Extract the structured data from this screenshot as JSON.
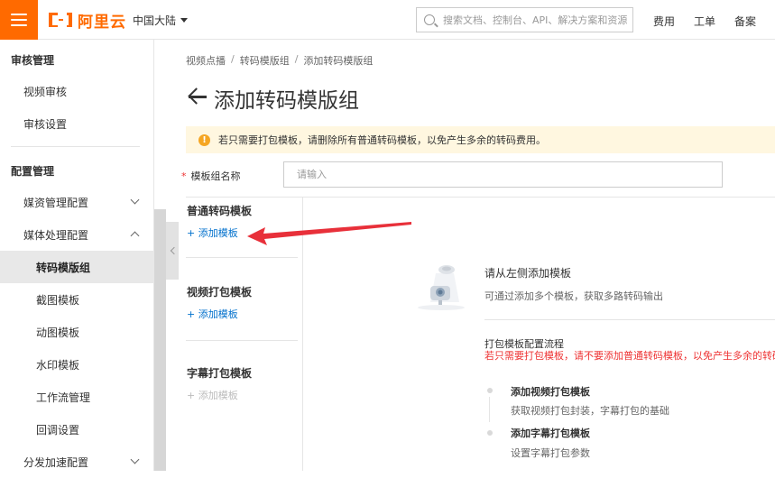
{
  "header": {
    "logo_text": "阿里云",
    "region": "中国大陆",
    "search_placeholder": "搜索文档、控制台、API、解决方案和资源",
    "links": [
      "费用",
      "工单",
      "备案"
    ]
  },
  "sidebar": {
    "group_audit": "审核管理",
    "audit_items": [
      "视频审核",
      "审核设置"
    ],
    "group_config": "配置管理",
    "media_mgmt": "媒资管理配置",
    "media_proc": "媒体处理配置",
    "proc_items": [
      "转码模版组",
      "截图模板",
      "动图模板",
      "水印模板",
      "工作流管理",
      "回调设置"
    ],
    "cdn": "分发加速配置"
  },
  "breadcrumb": [
    "视频点播",
    "转码模版组",
    "添加转码模版组"
  ],
  "page_title": "添加转码模版组",
  "notice": "若只需要打包模板，请删除所有普通转码模板，以免产生多余的转码费用。",
  "form": {
    "name_label": "模板组名称",
    "name_placeholder": "请输入"
  },
  "sections": [
    {
      "title": "普通转码模板",
      "add": "+ 添加模板"
    },
    {
      "title": "视频打包模板",
      "add": "+ 添加模板"
    },
    {
      "title": "字幕打包模板",
      "add": "+ 添加模板"
    }
  ],
  "empty": {
    "title": "请从左侧添加模板",
    "subtitle": "可通过添加多个模板，获取多路转码输出"
  },
  "flow": {
    "title": "打包模板配置流程",
    "warning": "若只需要打包模板，请不要添加普通转码模板，以免产生多余的转码",
    "steps": [
      {
        "title": "添加视频打包模板",
        "desc": "获取视频打包封装，字幕打包的基础"
      },
      {
        "title": "添加字幕打包模板",
        "desc": "设置字幕打包参数"
      }
    ]
  },
  "colors": {
    "brand": "#ff6a00",
    "link": "#0070cc",
    "warn": "#e33333",
    "annotation_arrow": "#e8303a"
  }
}
